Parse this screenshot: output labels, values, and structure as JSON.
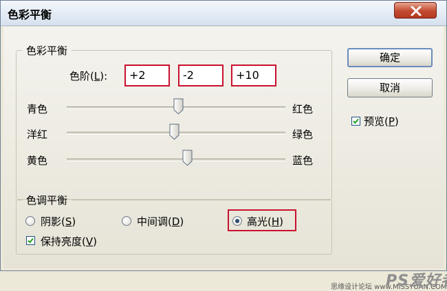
{
  "window": {
    "title": "色彩平衡"
  },
  "color_balance": {
    "legend": "色彩平衡",
    "levels_label": "色阶(",
    "levels_key": "L",
    "levels_suffix": "):",
    "levels": [
      "+2",
      "-2",
      "+10"
    ],
    "sliders": [
      {
        "left": "青色",
        "right": "红色",
        "value": 2
      },
      {
        "left": "洋红",
        "right": "绿色",
        "value": -2
      },
      {
        "left": "黄色",
        "right": "蓝色",
        "value": 10
      }
    ]
  },
  "tone_balance": {
    "legend": "色调平衡",
    "shadows": {
      "label": "阴影(",
      "key": "S",
      "suffix": ")",
      "selected": false
    },
    "midtones": {
      "label": "中间调(",
      "key": "D",
      "suffix": ")",
      "selected": false
    },
    "highlights": {
      "label": "高光(",
      "key": "H",
      "suffix": ")",
      "selected": true
    },
    "preserve": {
      "label": "保持亮度(",
      "key": "V",
      "suffix": ")",
      "checked": true
    }
  },
  "buttons": {
    "ok": "确定",
    "cancel": "取消"
  },
  "preview": {
    "label": "预览(",
    "key": "P",
    "suffix": ")",
    "checked": true
  },
  "watermark": {
    "small": "思缘设计论坛 www.MISSYUAN.COM",
    "big": "PS爱好者"
  },
  "colors": {
    "highlight_border": "#c8102e",
    "title_bar": "#d6e1ee"
  },
  "icons": [
    "close-icon",
    "checkmark-icon",
    "slider-thumb-icon",
    "radio-dot-icon"
  ]
}
